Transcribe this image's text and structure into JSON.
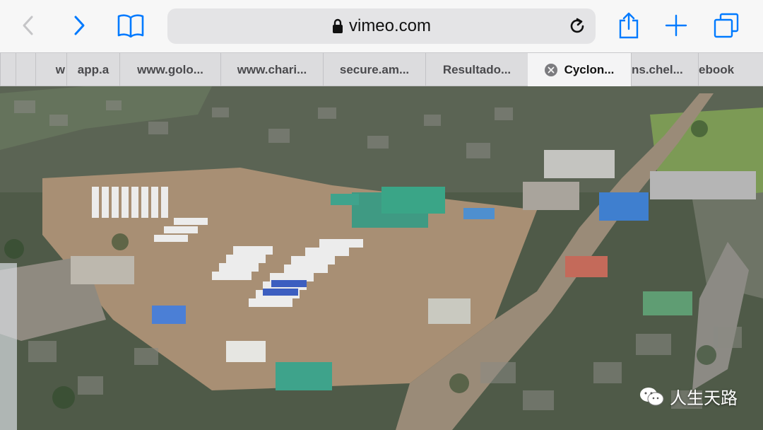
{
  "browser": {
    "url": "vimeo.com",
    "tabs": [
      {
        "label": "w"
      },
      {
        "label": "app.a"
      },
      {
        "label": "www.golo..."
      },
      {
        "label": "www.chari..."
      },
      {
        "label": "secure.am..."
      },
      {
        "label": "Resultado..."
      },
      {
        "label": "Cyclon...",
        "active": true
      },
      {
        "label": "ns.chel..."
      },
      {
        "label": "ebook"
      }
    ]
  },
  "icons": {
    "back": "chevron-left-icon",
    "forward": "chevron-right-icon",
    "bookmarks": "book-icon",
    "lock": "lock-icon",
    "reload": "reload-icon",
    "share": "share-icon",
    "new_tab": "plus-icon",
    "tabs": "tabs-icon"
  },
  "colors": {
    "accent": "#007aff",
    "toolbar": "#f7f7f7",
    "tabstrip": "#dcdcde",
    "floodwater": "#a88f74"
  },
  "watermark": {
    "text": "人生天路"
  }
}
